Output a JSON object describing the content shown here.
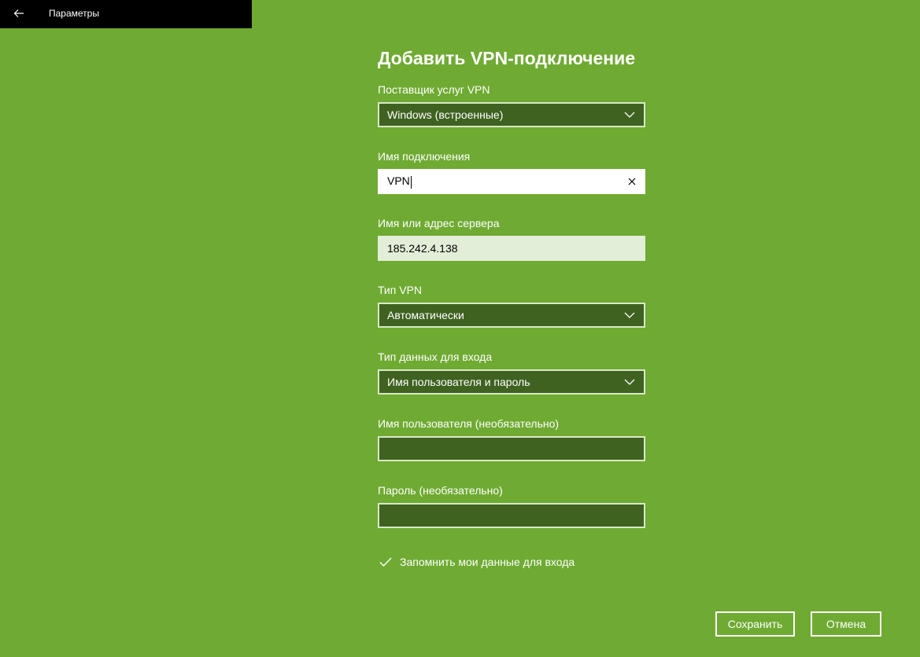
{
  "window": {
    "app_title": "Параметры"
  },
  "form": {
    "heading": "Добавить VPN-подключение",
    "provider": {
      "label": "Поставщик услуг VPN",
      "value": "Windows (встроенные)"
    },
    "connection_name": {
      "label": "Имя подключения",
      "value": "VPN"
    },
    "server": {
      "label": "Имя или адрес сервера",
      "value": "185.242.4.138"
    },
    "vpn_type": {
      "label": "Тип VPN",
      "value": "Автоматически"
    },
    "signin_type": {
      "label": "Тип данных для входа",
      "value": "Имя пользователя и пароль"
    },
    "username": {
      "label": "Имя пользователя (необязательно)",
      "value": ""
    },
    "password": {
      "label": "Пароль (необязательно)",
      "value": ""
    },
    "remember": {
      "label": "Запомнить мои данные для входа",
      "checked": true
    }
  },
  "buttons": {
    "save_label": "Сохранить",
    "cancel_label": "Отмена"
  },
  "colors": {
    "background": "#6faa32",
    "control_dark": "#3f6221",
    "titlebar": "#000000"
  },
  "icons": {
    "back": "back-arrow-icon",
    "dropdown": "chevron-down-icon",
    "clear": "close-icon",
    "check": "checkmark-icon"
  }
}
